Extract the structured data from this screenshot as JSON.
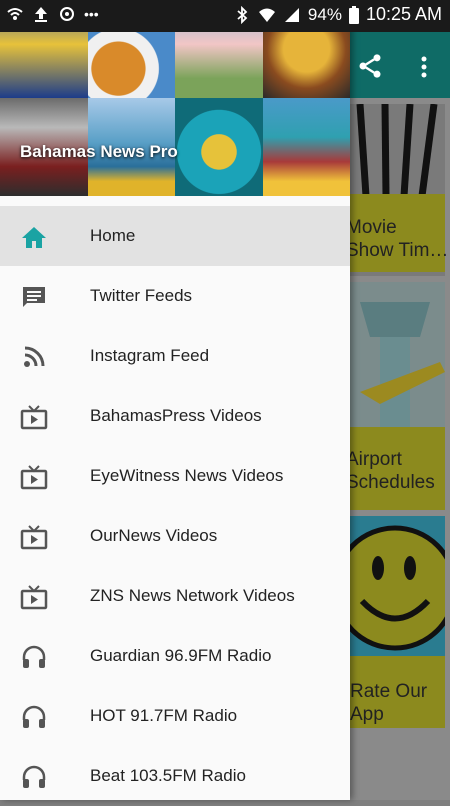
{
  "statusbar": {
    "battery": "94%",
    "time": "10:25 AM"
  },
  "drawer": {
    "header_title": "Bahamas News Pro",
    "items": [
      {
        "label": "Home",
        "icon": "home-icon",
        "active": true
      },
      {
        "label": "Twitter Feeds",
        "icon": "message-icon"
      },
      {
        "label": "Instagram Feed",
        "icon": "rss-icon"
      },
      {
        "label": "BahamasPress Videos",
        "icon": "tv-icon"
      },
      {
        "label": "EyeWitness News Videos",
        "icon": "tv-icon"
      },
      {
        "label": "OurNews Videos",
        "icon": "tv-icon"
      },
      {
        "label": "ZNS News Network Videos",
        "icon": "tv-icon"
      },
      {
        "label": "Guardian 96.9FM Radio",
        "icon": "headphones-icon"
      },
      {
        "label": "HOT 91.7FM Radio",
        "icon": "headphones-icon"
      },
      {
        "label": "Beat 103.5FM Radio",
        "icon": "headphones-icon"
      }
    ]
  },
  "background": {
    "tile_movie": "Movie\nShow Tim…",
    "tile_airport": "Airport\nSchedules",
    "tile_rate": "Rate Our\nApp"
  },
  "colors": {
    "accent": "#1aa3a3",
    "appbar": "#0f6b66",
    "drawer_bg": "#fafafa",
    "active_item_bg": "#e2e2e2"
  }
}
